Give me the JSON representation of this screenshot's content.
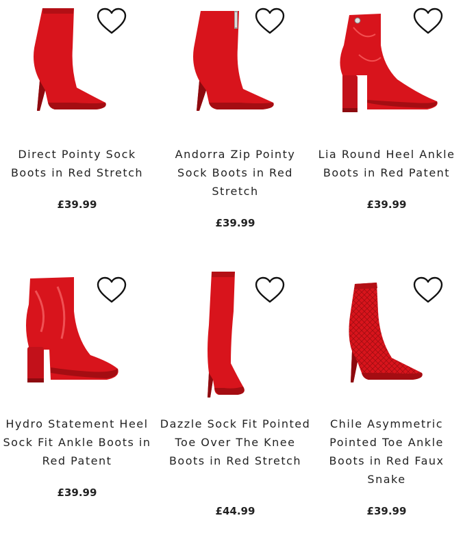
{
  "products": [
    {
      "name": "Direct Pointy Sock Boots in Red Stretch",
      "price": "£39.99",
      "image_icon": "red-sock-boot-icon",
      "wishlist_icon": "heart-outline-icon"
    },
    {
      "name": "Andorra Zip Pointy Sock Boots in Red Stretch",
      "price": "£39.99",
      "image_icon": "red-zip-sock-boot-icon",
      "wishlist_icon": "heart-outline-icon"
    },
    {
      "name": "Lia Round Heel Ankle Boots in Red Patent",
      "price": "£39.99",
      "image_icon": "red-block-heel-boot-icon",
      "wishlist_icon": "heart-outline-icon"
    },
    {
      "name": "Hydro Statement Heel Sock Fit Ankle Boots in Red Patent",
      "price": "£39.99",
      "image_icon": "red-patent-ankle-boot-icon",
      "wishlist_icon": "heart-outline-icon"
    },
    {
      "name": "Dazzle Sock Fit Pointed Toe Over The Knee Boots in Red Stretch",
      "price": "£44.99",
      "image_icon": "red-over-knee-boot-icon",
      "wishlist_icon": "heart-outline-icon"
    },
    {
      "name": "Chile Asymmetric Pointed Toe Ankle Boots in Red Faux Snake",
      "price": "£39.99",
      "image_icon": "red-snake-boot-icon",
      "wishlist_icon": "heart-outline-icon"
    }
  ],
  "colors": {
    "boot_red": "#d8141c",
    "boot_shadow": "#a40d12",
    "text": "#222222",
    "heart_stroke": "#111111"
  }
}
